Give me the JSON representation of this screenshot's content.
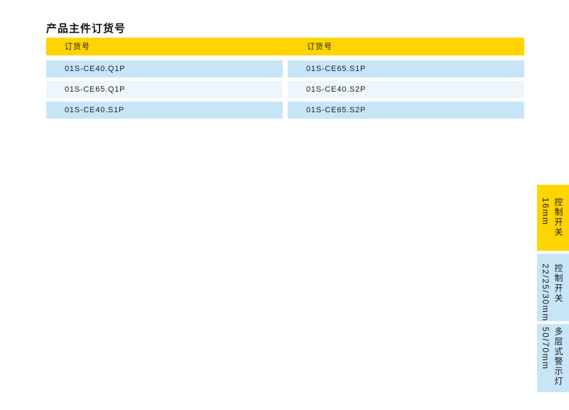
{
  "section": {
    "title": "产品主件订货号"
  },
  "table": {
    "headers": [
      "订货号",
      "订货号"
    ],
    "rows": [
      [
        "01S-CE40.Q1P",
        "01S-CE65.S1P"
      ],
      [
        "01S-CE65.Q1P",
        "01S-CE40.S2P"
      ],
      [
        "01S-CE40.S1P",
        "01S-CE65.S2P"
      ]
    ]
  },
  "side_tabs": [
    {
      "title": "控制开关",
      "subtitle": "16mm",
      "active": true
    },
    {
      "title": "控制开关",
      "subtitle": "22/25/30mm",
      "active": false
    },
    {
      "title": "多层式警示灯",
      "subtitle": "50/70mm",
      "active": false
    }
  ],
  "colors": {
    "accent_yellow": "#ffd400",
    "row_blue": "#c8e5f8",
    "row_light": "#eef6fc"
  }
}
